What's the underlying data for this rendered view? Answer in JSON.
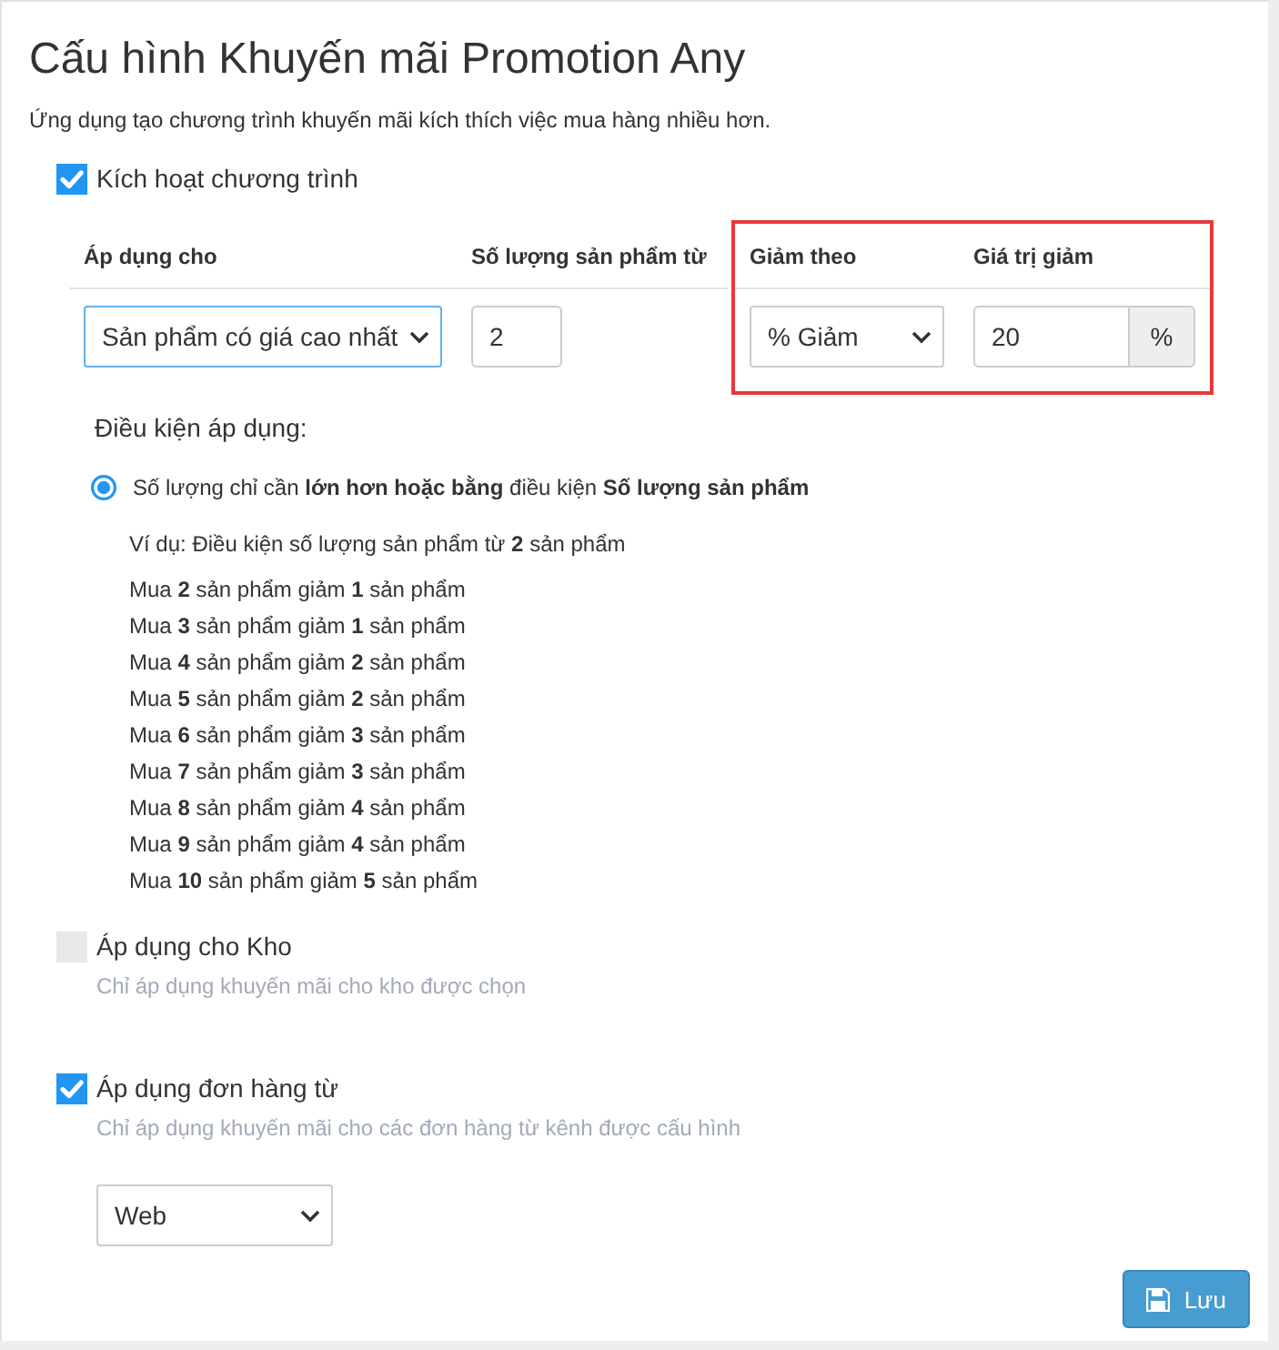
{
  "title": "Cấu hình Khuyến mãi Promotion Any",
  "subtitle": "Ứng dụng tạo chương trình khuyến mãi kích thích việc mua hàng nhiều hơn.",
  "activate": {
    "label": "Kích hoạt chương trình",
    "checked": true
  },
  "settings_table": {
    "columns": [
      {
        "header": "Áp dụng cho",
        "kind": "select",
        "value": "Sản phẩm có giá cao nhất",
        "focused": true,
        "highlighted": false
      },
      {
        "header": "Số lượng sản phẩm từ",
        "kind": "input",
        "value": "2",
        "focused": false,
        "highlighted": false
      },
      {
        "header": "Giảm theo",
        "kind": "select",
        "value": "% Giảm",
        "focused": false,
        "highlighted": true
      },
      {
        "header": "Giá trị giảm",
        "kind": "input_addon",
        "value": "20",
        "addon": "%",
        "focused": false,
        "highlighted": true
      }
    ]
  },
  "conditions": {
    "heading": "Điều kiện áp dụng:",
    "options": [
      {
        "label": "Số lượng chỉ cần **lớn hơn hoặc bằng** điều kiện **Số lượng sản phẩm**",
        "selected": true
      }
    ],
    "example": "Ví dụ: Điều kiện số lượng sản phẩm từ **2** sản phẩm",
    "examples": [
      "Mua **2** sản phẩm giảm **1** sản phẩm",
      "Mua **3** sản phẩm giảm **1** sản phẩm",
      "Mua **4** sản phẩm giảm **2** sản phẩm",
      "Mua **5** sản phẩm giảm **2** sản phẩm",
      "Mua **6** sản phẩm giảm **3** sản phẩm",
      "Mua **7** sản phẩm giảm **3** sản phẩm",
      "Mua **8** sản phẩm giảm **4** sản phẩm",
      "Mua **9** sản phẩm giảm **4** sản phẩm",
      "Mua **10** sản phẩm giảm **5** sản phẩm"
    ]
  },
  "options": [
    {
      "label": "Áp dụng cho Kho",
      "checked": false,
      "hint": "Chỉ áp dụng khuyến mãi cho kho được chọn"
    },
    {
      "label": "Áp dụng đơn hàng từ",
      "checked": true,
      "hint": "Chỉ áp dụng khuyến mãi cho các đơn hàng từ kênh được cấu hình",
      "select": {
        "value": "Web"
      }
    }
  ],
  "save_button": {
    "label": "Lưu"
  }
}
